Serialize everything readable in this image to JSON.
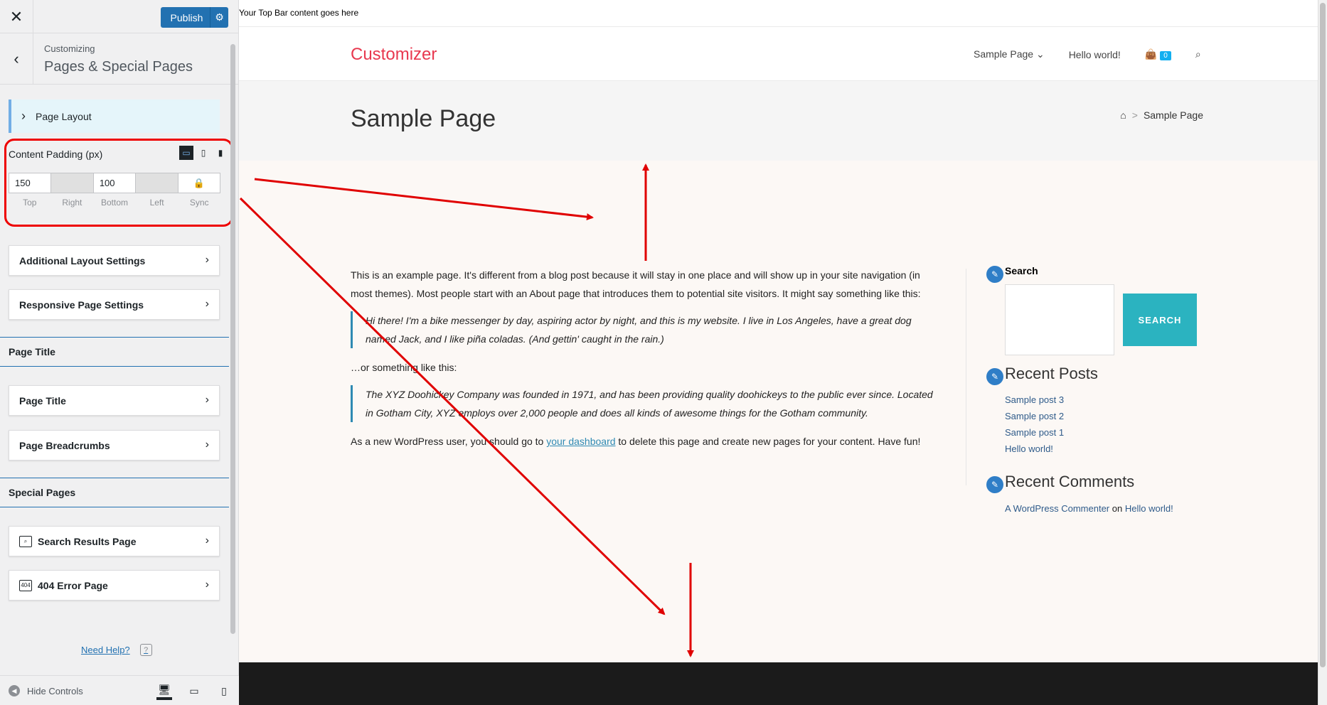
{
  "customizer": {
    "publish_label": "Publish",
    "breadcrumb_small": "Customizing",
    "section_title": "Pages & Special Pages",
    "page_layout_label": "Page Layout",
    "content_padding": {
      "title": "Content Padding (px)",
      "top": "150",
      "right": "",
      "bottom": "100",
      "left": "",
      "labels": [
        "Top",
        "Right",
        "Bottom",
        "Left",
        "Sync"
      ]
    },
    "cards": {
      "additional_layout": "Additional Layout Settings",
      "responsive": "Responsive Page Settings",
      "page_title": "Page Title",
      "page_breadcrumbs": "Page Breadcrumbs",
      "search_results": "Search Results Page",
      "error_404": "404 Error Page"
    },
    "groups": {
      "page_title": "Page Title",
      "special_pages": "Special Pages"
    },
    "need_help": "Need Help?",
    "hide_controls": "Hide Controls",
    "accent_color": "#2271b1",
    "highlight_color": "#e00000"
  },
  "site": {
    "top_bar_text": "Your Top Bar content goes here",
    "logo": "Customizer",
    "logo_color": "#e8384f",
    "nav": {
      "sample_page": "Sample Page",
      "hello_world": "Hello world!",
      "cart_count": "0"
    },
    "page_title": "Sample Page",
    "breadcrumb_current": "Sample Page",
    "content": {
      "p1": "This is an example page. It's different from a blog post because it will stay in one place and will show up in your site navigation (in most themes). Most people start with an About page that introduces them to potential site visitors. It might say something like this:",
      "quote1": "Hi there! I'm a bike messenger by day, aspiring actor by night, and this is my website. I live in Los Angeles, have a great dog named Jack, and I like piña coladas. (And gettin' caught in the rain.)",
      "p2": "…or something like this:",
      "quote2": "The XYZ Doohickey Company was founded in 1971, and has been providing quality doohickeys to the public ever since. Located in Gotham City, XYZ employs over 2,000 people and does all kinds of awesome things for the Gotham community.",
      "p3_before": "As a new WordPress user, you should go to ",
      "p3_link": "your dashboard",
      "p3_after": " to delete this page and create new pages for your content. Have fun!"
    },
    "sidebar": {
      "search_title": "Search",
      "search_button": "SEARCH",
      "recent_posts_title": "Recent Posts",
      "recent_posts": [
        "Sample post 3",
        "Sample post 2",
        "Sample post 1",
        "Hello world!"
      ],
      "recent_comments_title": "Recent Comments",
      "comment_author": "A WordPress Commenter",
      "comment_on": "on",
      "comment_post": "Hello world!"
    }
  }
}
